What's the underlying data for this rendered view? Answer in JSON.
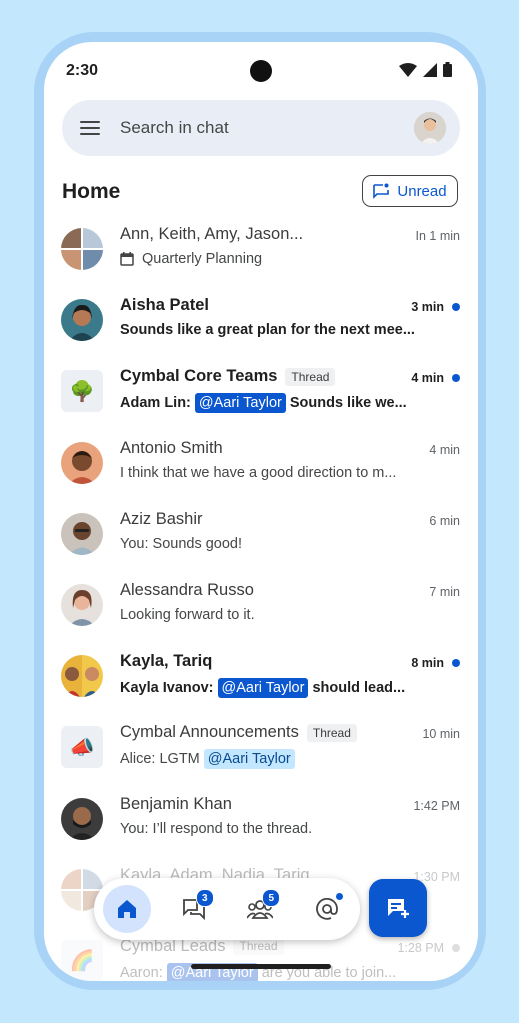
{
  "status_bar": {
    "time": "2:30"
  },
  "search": {
    "placeholder": "Search in chat"
  },
  "header": {
    "title": "Home",
    "unread_label": "Unread"
  },
  "colors": {
    "accent": "#0b57d0",
    "background": "#c3e7fd",
    "search_bg": "#e9eef6"
  },
  "chats": [
    {
      "name": "Ann, Keith, Amy, Jason...",
      "time": "In 1 min",
      "preview": "Quarterly Planning",
      "preview_icon": "calendar-icon",
      "unread": false
    },
    {
      "name": "Aisha Patel",
      "time": "3 min",
      "preview": "Sounds like a great plan for the next mee...",
      "unread": true
    },
    {
      "name": "Cymbal Core Teams",
      "thread": "Thread",
      "time": "4 min",
      "preview_prefix": "Adam Lin:",
      "mention": "@Aari Taylor",
      "preview_suffix": "Sounds like we...",
      "unread": true
    },
    {
      "name": "Antonio Smith",
      "time": "4 min",
      "preview": "I think that we have a good direction to m...",
      "unread": false
    },
    {
      "name": "Aziz Bashir",
      "time": "6 min",
      "preview": "You: Sounds good!",
      "unread": false
    },
    {
      "name": "Alessandra Russo",
      "time": "7 min",
      "preview": "Looking forward to it.",
      "unread": false
    },
    {
      "name": "Kayla, Tariq",
      "time": "8 min",
      "preview_prefix": "Kayla Ivanov:",
      "mention": "@Aari Taylor",
      "preview_suffix": "should lead...",
      "unread": true
    },
    {
      "name": "Cymbal Announcements",
      "thread": "Thread",
      "time": "10 min",
      "preview_prefix": "Alice: LGTM",
      "mention": "@Aari Taylor",
      "preview_suffix": "",
      "unread": false
    },
    {
      "name": "Benjamin Khan",
      "time": "1:42 PM",
      "preview": "You: I’ll respond to the thread.",
      "unread": false
    },
    {
      "name": "Kayla, Adam, Nadia, Tariq",
      "time": "1:30 PM",
      "preview": "",
      "unread": false
    },
    {
      "name": "Cymbal Leads",
      "thread": "Thread",
      "time": "1:28 PM",
      "preview_prefix": "Aaron:",
      "mention": "@Aari Taylor",
      "preview_suffix": "are you able to join...",
      "unread": false
    }
  ],
  "nav": {
    "chat_badge": "3",
    "spaces_badge": "5"
  }
}
